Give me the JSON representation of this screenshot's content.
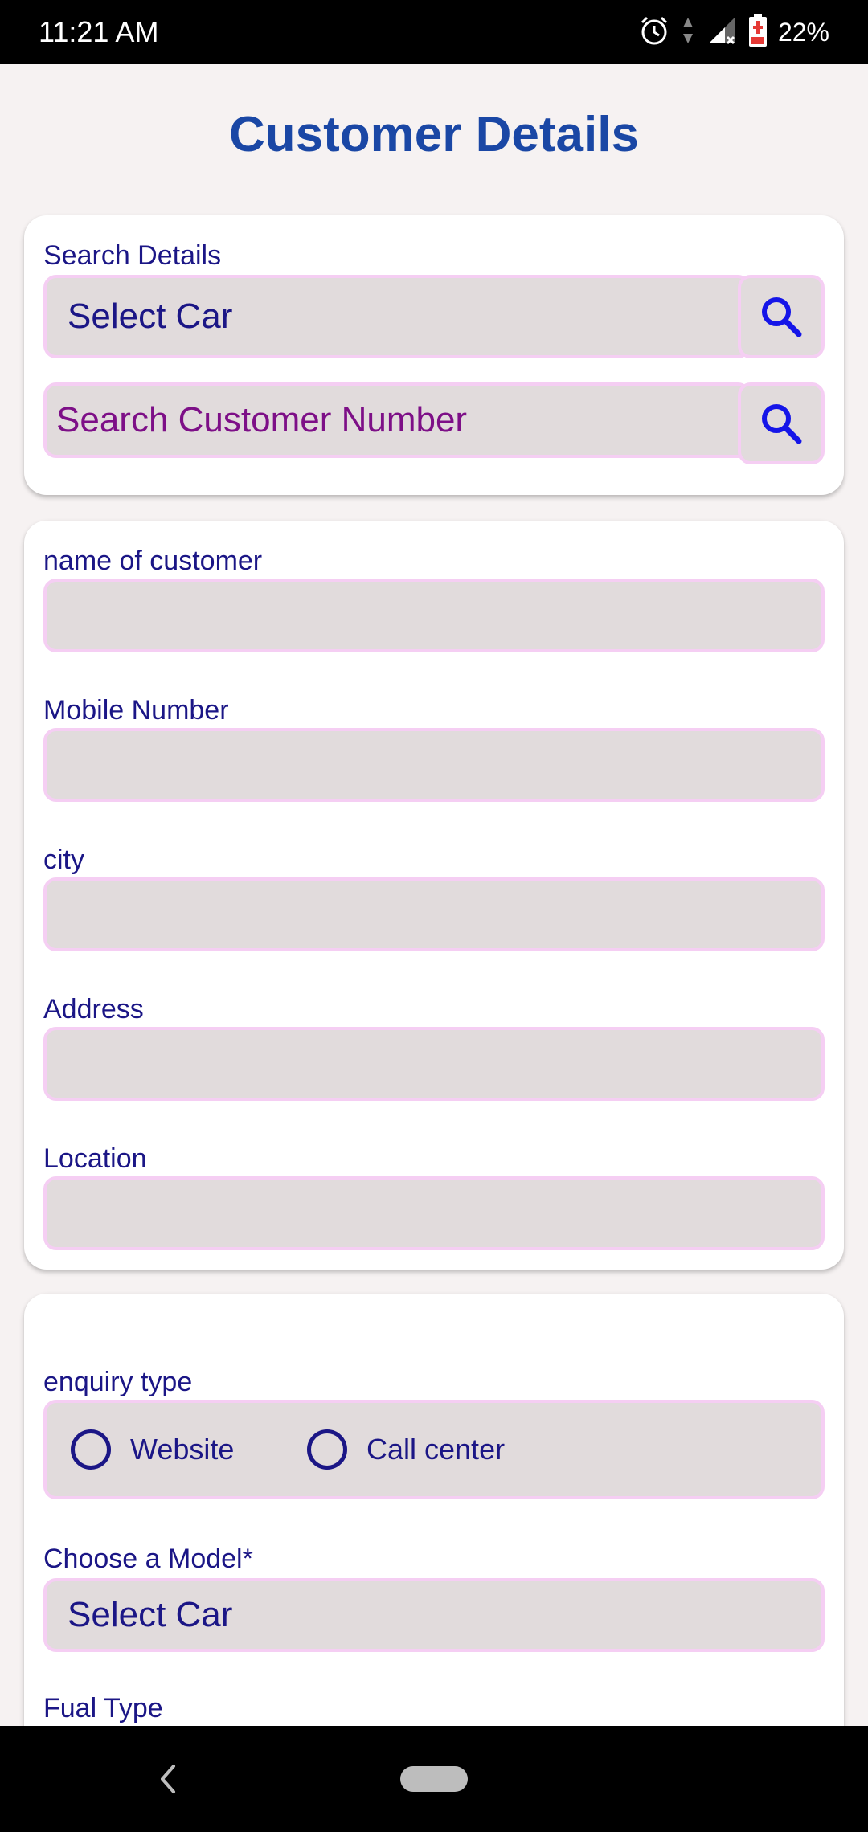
{
  "status_bar": {
    "time": "11:21 AM",
    "battery": "22%",
    "icons": [
      "alarm-icon",
      "data-arrows-icon",
      "signal-icon",
      "battery-charging-icon"
    ]
  },
  "page": {
    "title": "Customer Details"
  },
  "search_section": {
    "label": "Search Details",
    "car_select_value": "Select Car",
    "customer_search_placeholder": "Search Customer Number",
    "search_icon": "search-icon"
  },
  "customer_section": {
    "name_label": "name of customer",
    "mobile_label": "Mobile Number",
    "city_label": "city",
    "address_label": "Address",
    "location_label": "Location"
  },
  "enquiry_section": {
    "enquiry_label": "enquiry type",
    "options": [
      "Website",
      "Call center"
    ],
    "model_label": "Choose a Model*",
    "model_value": "Select Car",
    "fuel_label": "Fual Type"
  },
  "navigation_bar": {
    "icons": [
      "back-icon",
      "home-pill-icon"
    ]
  },
  "colors": {
    "title": "#1a47a5",
    "text": "#1b1686",
    "placeholder": "#7d0f87",
    "field_fill": "#e1dbdc",
    "field_border": "#f5cef3",
    "search_icon": "#1515e8"
  }
}
